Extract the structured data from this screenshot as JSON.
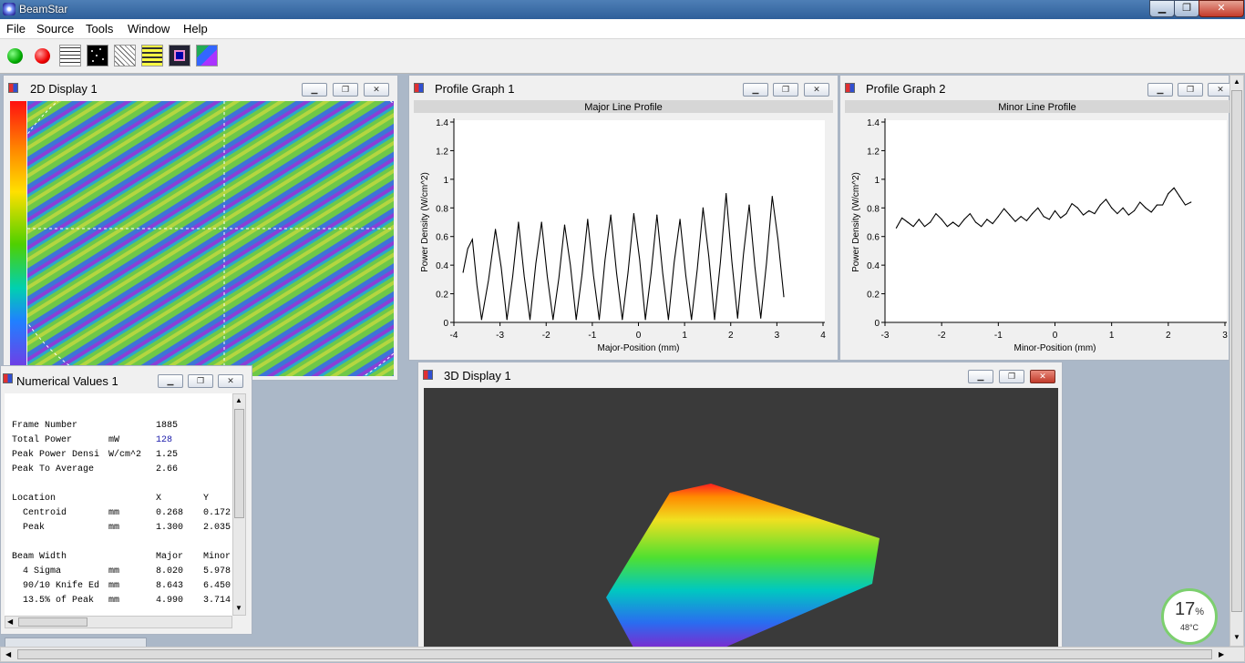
{
  "app": {
    "title": "BeamStar"
  },
  "menu": [
    "File",
    "Source",
    "Tools",
    "Window",
    "Help"
  ],
  "toolbar_icons": [
    "start-icon",
    "stop-icon",
    "background-icon",
    "noise-icon",
    "filter-icon",
    "settings-icon",
    "display-icon",
    "report-icon"
  ],
  "windows": {
    "display2d": {
      "title": "2D Display 1"
    },
    "profile1": {
      "title": "Profile Graph 1",
      "chart_title": "Major Line Profile",
      "xlabel": "Major-Position (mm)",
      "ylabel": "Power Density (W/cm^2)",
      "xticks": [
        "-4",
        "-3",
        "-2",
        "-1",
        "0",
        "1",
        "2",
        "3",
        "4"
      ],
      "yticks": [
        "0",
        "0.2",
        "0.4",
        "0.6",
        "0.8",
        "1",
        "1.2",
        "1.4"
      ]
    },
    "profile2": {
      "title": "Profile Graph 2",
      "chart_title": "Minor Line Profile",
      "xlabel": "Minor-Position (mm)",
      "ylabel": "Power Density (W/cm^2)",
      "xticks": [
        "-3",
        "-2",
        "-1",
        "0",
        "1",
        "2",
        "3"
      ],
      "yticks": [
        "0",
        "0.2",
        "0.4",
        "0.6",
        "0.8",
        "1",
        "1.2",
        "1.4"
      ]
    },
    "numerical": {
      "title": "Numerical Values 1",
      "rows": [
        [
          "Frame Number",
          "",
          "1885",
          ""
        ],
        [
          "Total Power",
          "mW",
          "128",
          ""
        ],
        [
          "Peak Power Densi",
          "W/cm^2",
          "1.25",
          ""
        ],
        [
          "Peak To Average",
          "",
          "2.66",
          ""
        ],
        [
          "",
          "",
          "",
          ""
        ],
        [
          "Location",
          "",
          "X",
          "Y"
        ],
        [
          "  Centroid",
          "mm",
          "0.268",
          "0.172"
        ],
        [
          "  Peak",
          "mm",
          "1.300",
          "2.035"
        ],
        [
          "",
          "",
          "",
          ""
        ],
        [
          "Beam Width",
          "",
          "Major",
          "Minor"
        ],
        [
          "  4 Sigma",
          "mm",
          "8.020",
          "5.978"
        ],
        [
          "  90/10 Knife Ed",
          "mm",
          "8.643",
          "6.450"
        ],
        [
          "  13.5% of Peak",
          "mm",
          "4.990",
          "3.714"
        ]
      ]
    },
    "display3d": {
      "title": "3D Display 1"
    }
  },
  "temp": {
    "percent": "17",
    "unit": "%",
    "celsius": "48°C"
  },
  "chart_data": [
    {
      "type": "line",
      "title": "Major Line Profile",
      "xlabel": "Major-Position (mm)",
      "ylabel": "Power Density (W/cm^2)",
      "xlim": [
        -4,
        4
      ],
      "ylim": [
        0,
        1.4
      ],
      "series": [
        {
          "x": [
            -3.8,
            -3.6,
            -3.4,
            -3.1,
            -2.85,
            -2.6,
            -2.35,
            -2.1,
            -1.85,
            -1.6,
            -1.35,
            -1.1,
            -0.85,
            -0.6,
            -0.35,
            -0.1,
            0.15,
            0.4,
            0.65,
            0.9,
            1.15,
            1.4,
            1.65,
            1.9,
            2.15,
            2.4,
            2.65,
            2.9,
            3.15
          ],
          "y": [
            0.35,
            0.58,
            0.02,
            0.65,
            0.02,
            0.7,
            0.02,
            0.7,
            0.02,
            0.68,
            0.02,
            0.72,
            0.02,
            0.75,
            0.02,
            0.76,
            0.02,
            0.75,
            0.02,
            0.72,
            0.02,
            0.8,
            0.02,
            0.9,
            0.03,
            0.82,
            0.03,
            0.88,
            0.18
          ]
        }
      ]
    },
    {
      "type": "line",
      "title": "Minor Line Profile",
      "xlabel": "Minor-Position (mm)",
      "ylabel": "Power Density (W/cm^2)",
      "xlim": [
        -3,
        3
      ],
      "ylim": [
        0,
        1.4
      ],
      "series": [
        {
          "x": [
            -2.8,
            -2.6,
            -2.4,
            -2.2,
            -2.0,
            -1.8,
            -1.6,
            -1.4,
            -1.2,
            -1.0,
            -0.8,
            -0.6,
            -0.4,
            -0.2,
            0.0,
            0.2,
            0.4,
            0.6,
            0.8,
            1.0,
            1.2,
            1.4,
            1.6,
            1.8,
            2.0,
            2.2,
            2.4
          ],
          "y": [
            0.66,
            0.7,
            0.72,
            0.7,
            0.72,
            0.7,
            0.72,
            0.7,
            0.72,
            0.74,
            0.75,
            0.74,
            0.76,
            0.74,
            0.78,
            0.76,
            0.8,
            0.78,
            0.82,
            0.8,
            0.8,
            0.78,
            0.8,
            0.82,
            0.9,
            0.88,
            0.84
          ]
        }
      ]
    }
  ]
}
